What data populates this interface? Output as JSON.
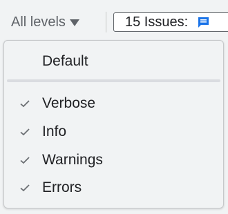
{
  "toolbar": {
    "levels_label": "All levels",
    "issues_label": "15 Issues:",
    "issues_icon": "message-icon"
  },
  "menu": {
    "items": [
      {
        "label": "Default",
        "checked": false
      },
      {
        "label": "Verbose",
        "checked": true
      },
      {
        "label": "Info",
        "checked": true
      },
      {
        "label": "Warnings",
        "checked": true
      },
      {
        "label": "Errors",
        "checked": true
      }
    ]
  },
  "colors": {
    "background": "#f1f3f4",
    "text": "#202124",
    "muted": "#5f6368",
    "accent": "#1a73e8"
  }
}
